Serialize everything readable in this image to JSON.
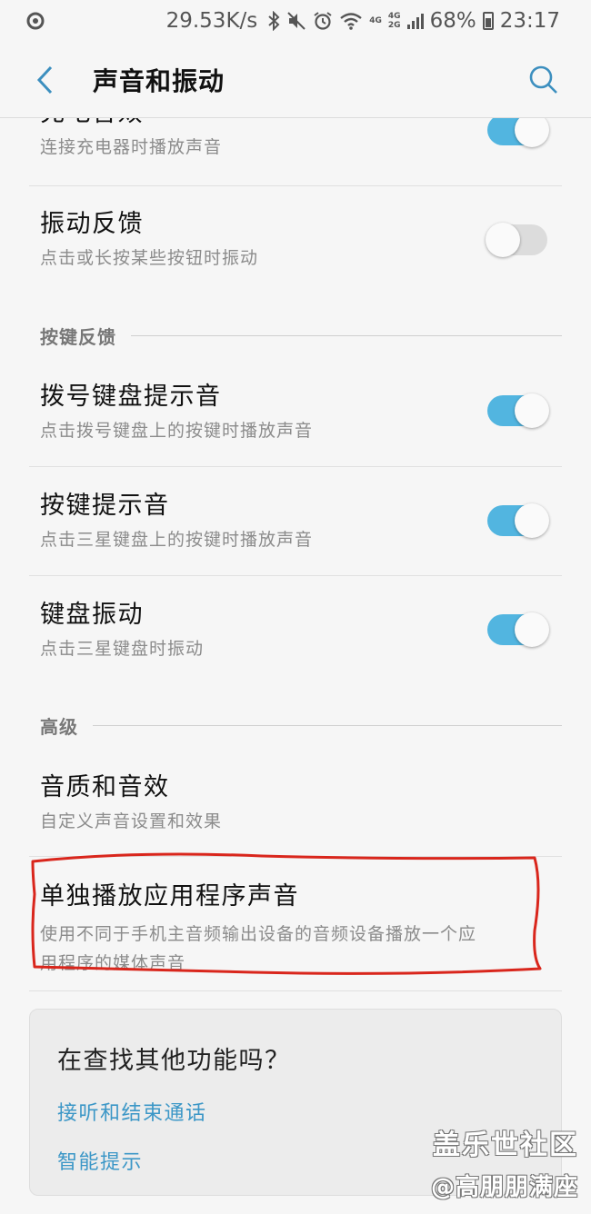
{
  "status_bar": {
    "speed": "29.53K/s",
    "net_top": "4G",
    "net_bottom": "2G",
    "net_single": "4G",
    "battery": "68%",
    "time": "23:17"
  },
  "header": {
    "title": "声音和振动"
  },
  "items": [
    {
      "title": "充电音效",
      "subtitle": "连接充电器时播放声音",
      "toggle": "on"
    },
    {
      "title": "振动反馈",
      "subtitle": "点击或长按某些按钮时振动",
      "toggle": "off"
    },
    {
      "title": "拨号键盘提示音",
      "subtitle": "点击拨号键盘上的按键时播放声音",
      "toggle": "on"
    },
    {
      "title": "按键提示音",
      "subtitle": "点击三星键盘上的按键时播放声音",
      "toggle": "on"
    },
    {
      "title": "键盘振动",
      "subtitle": "点击三星键盘时振动",
      "toggle": "on"
    },
    {
      "title": "音质和音效",
      "subtitle": "自定义声音设置和效果"
    },
    {
      "title": "单独播放应用程序声音",
      "subtitle_line1": "使用不同于手机主音频输出设备的音频设备播放一个应",
      "subtitle_line2": "用程序的媒体声音"
    }
  ],
  "sections": {
    "key_feedback": "按键反馈",
    "advanced": "高级"
  },
  "card": {
    "title": "在查找其他功能吗？",
    "links": [
      "接听和结束通话",
      "智能提示"
    ]
  },
  "watermark": {
    "line1": "盖乐世社区",
    "line2": "@高朋朋满座"
  },
  "colors": {
    "accent": "#52b5e0",
    "link": "#3c97c7",
    "annotation": "#d9261c"
  }
}
